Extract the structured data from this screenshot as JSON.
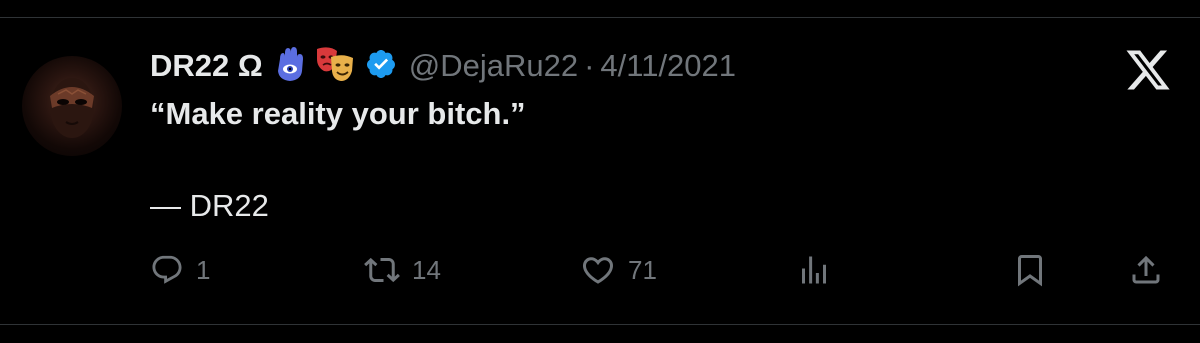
{
  "tweet": {
    "display_name": "DR22 Ω",
    "emoji_1": "🪬",
    "emoji_2": "🎭",
    "handle": "@DejaRu22",
    "separator": "·",
    "date": "4/11/2021",
    "text": "“Make reality your bitch.”",
    "signature": "— DR22"
  },
  "actions": {
    "replies": "1",
    "retweets": "14",
    "likes": "71"
  },
  "icons": {
    "avatar": "avatar-masked-face",
    "verified": "verified-badge-icon",
    "logo": "x-logo-icon",
    "reply": "reply-icon",
    "retweet": "retweet-icon",
    "like": "heart-icon",
    "views": "views-icon",
    "bookmark": "bookmark-icon",
    "share": "share-icon"
  },
  "colors": {
    "background": "#000000",
    "text_primary": "#e7e9ea",
    "text_secondary": "#71767b",
    "verified_blue": "#1d9bf0",
    "divider": "#2f3336"
  }
}
